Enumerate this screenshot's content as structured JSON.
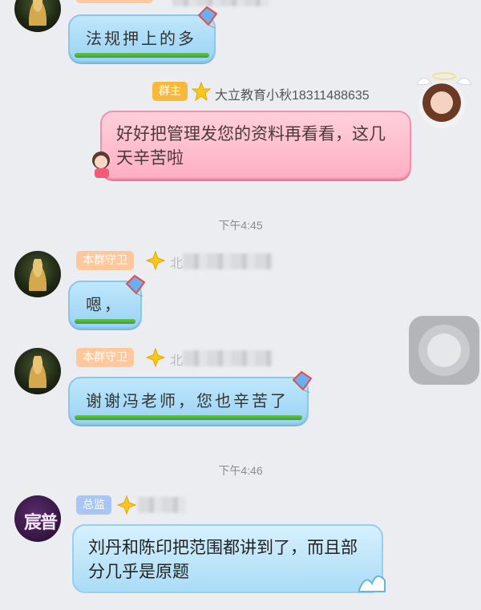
{
  "messages": [
    {
      "text": "法规押上的多"
    },
    {
      "role_tag": "群主",
      "sender": "大立教育小秋18311488635",
      "text": "好好把管理发您的资料再看看，这几天辛苦啦"
    },
    {
      "role_tag": "本群守卫",
      "sender": "北",
      "text": "嗯，"
    },
    {
      "role_tag": "本群守卫",
      "sender": "北",
      "text": "谢谢冯老师，您也辛苦了"
    },
    {
      "role_tag": "总监",
      "text": "刘丹和陈印把范围都讲到了，而且部分几乎是原题"
    }
  ],
  "timestamps": [
    "下午4:45",
    "下午4:46"
  ],
  "avatar_purple_text": "宸普",
  "icons": {
    "star": "star-badge-icon",
    "kite": "kite-icon",
    "assistive_touch": "assistive-touch-icon"
  },
  "colors": {
    "background": "#ecedf1",
    "owner_tag": "#f6b93b",
    "guard_tag": "#ffc79c",
    "director_tag": "#a9c5f3",
    "blue_bubble": "#bfe7fb",
    "pink_bubble": "#ffd0db"
  }
}
